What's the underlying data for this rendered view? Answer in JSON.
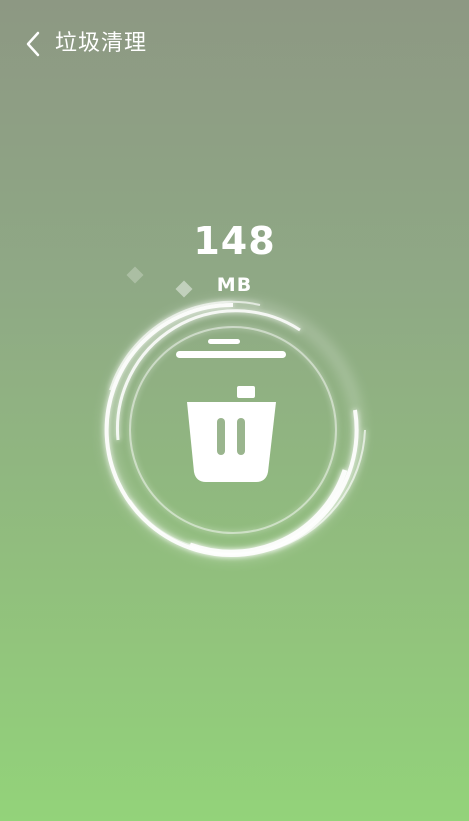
{
  "header": {
    "back_icon": "chevron-left-icon",
    "title": "垃圾清理"
  },
  "junk": {
    "size_value": "148",
    "size_unit": "MB"
  },
  "illustration": {
    "center_icon": "trash-icon",
    "ring_effect": "swirl-rings"
  },
  "colors": {
    "background_top": "#8d9883",
    "background_bottom": "#93d37a",
    "foreground": "#ffffff"
  }
}
